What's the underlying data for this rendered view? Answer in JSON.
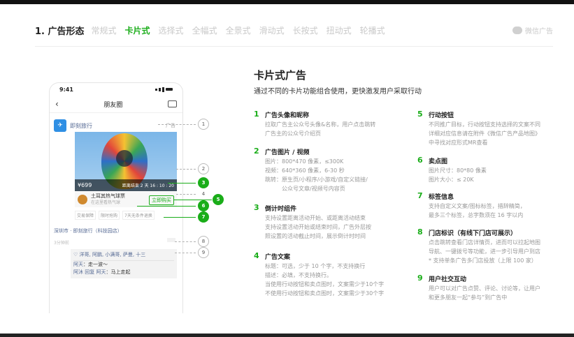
{
  "tabs": {
    "title": "1. 广告形态",
    "items": [
      "常规式",
      "卡片式",
      "选择式",
      "全幅式",
      "全景式",
      "滑动式",
      "长按式",
      "扭动式",
      "轮播式"
    ],
    "active_index": 1,
    "wechat_label": "微信广告"
  },
  "phone": {
    "time": "9:41",
    "nav_title": "朋友圈",
    "ad_name": "即刻旅行",
    "ad_tag": "广告",
    "price": "¥699",
    "countdown": "距离结束 2 天 16 : 10 : 20",
    "product_name": "土耳其热气球票",
    "product_sub": "在这里看热气球",
    "buy_label": "立即购买",
    "labels": [
      "交易保障",
      "限时抢购",
      "7天无条件退换"
    ],
    "store": "深圳市 · 即刻旅行（科技园店）",
    "time_ago": "3分钟前",
    "likes": "♡ 洋哥, 阿鹏, 小满哥, 萨曼, 十三",
    "comments": [
      {
        "name": "阿天",
        "text": "走一波～"
      },
      {
        "name": "阿沐 回复 阿天",
        "text": "马上走起"
      }
    ]
  },
  "markers": [
    "1",
    "2",
    "3",
    "4",
    "5",
    "6",
    "7",
    "8",
    "9"
  ],
  "section": {
    "title": "卡片式广告",
    "subtitle": "通过不同的卡片功能组合使用，更快激发用户采取行动"
  },
  "features_left": [
    {
      "num": "1",
      "title": "广告头像和昵称",
      "lines": [
        "拉取广告主公众号头像&名称，用户点击跳转",
        "广告主的公众号介绍页"
      ]
    },
    {
      "num": "2",
      "title": "广告图片 / 视频",
      "lines": [
        "图片：800*470 像素，≤300K",
        "视频：640*360 像素，6-30 秒",
        "跳转：原生页/小程序/小游戏/自定义链接/",
        "　　　公众号文章/视频号内容页"
      ]
    },
    {
      "num": "3",
      "title": "倒计时组件",
      "lines": [
        "支持设置距离活动开始、或距离活动结束",
        "支持设置活动开始或结束时间，广告外层按",
        "照设置的活动截止时间，展示倒计时时间"
      ]
    },
    {
      "num": "4",
      "title": "广告文案",
      "lines": [
        "标题：可选，少于 10 个字，不支持换行",
        "描述：必填，不支持换行。",
        "当使用行动按钮和卖点图时，文案需少于10个字",
        "不使用行动按钮和卖点图时，文案需少于30个字"
      ]
    }
  ],
  "features_right": [
    {
      "num": "5",
      "title": "行动按钮",
      "lines": [
        "不同推广目标，行动按钮支持选择的文案不同",
        "详细对应信息请在附件《微信广告产品地图》",
        "中寻找对应形式MR查看"
      ]
    },
    {
      "num": "6",
      "title": "卖点图",
      "lines": [
        "图片尺寸：80*80 像素",
        "图片大小：≤ 20K"
      ]
    },
    {
      "num": "7",
      "title": "标签信息",
      "lines": [
        "支持自定义文案/图标标签，措辞精简，",
        "最多三个标签，总字数须在 16 字以内"
      ]
    },
    {
      "num": "8",
      "title": "门店标识（有线下门店可展示）",
      "lines": [
        "点击跳转查看门店详情页，进而可以拉起地图",
        "导航、一键拨号等功能，进一步引导用户到店",
        "* 支持单条广告多门店投放（上限 100 家）"
      ]
    },
    {
      "num": "9",
      "title": "用户社交互动",
      "lines": [
        "用户可以对广告点赞、评论、讨论等，让用户",
        "和更多朋友一起“参与”到广告中"
      ]
    }
  ]
}
